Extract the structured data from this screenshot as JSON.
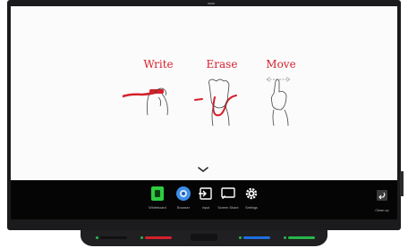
{
  "gestures": [
    {
      "label": "Write",
      "icon": "hand-writing-with-pen-icon"
    },
    {
      "label": "Erase",
      "icon": "palm-erasing-icon"
    },
    {
      "label": "Move",
      "icon": "two-finger-move-icon"
    }
  ],
  "taskbar": {
    "apps": [
      {
        "label": "Whiteboard",
        "icon": "whiteboard-icon",
        "color": "#2ecc40"
      },
      {
        "label": "Browser",
        "icon": "browser-globe-icon",
        "color": "#3b8ee8"
      },
      {
        "label": "Input",
        "icon": "input-source-icon",
        "color": "#ffffff"
      },
      {
        "label": "Screen Share",
        "icon": "screen-share-icon",
        "color": "#ffffff"
      },
      {
        "label": "Settings",
        "icon": "gear-icon",
        "color": "#ffffff"
      }
    ],
    "exit": {
      "label": "Clean up",
      "icon": "exit-arrow-icon"
    }
  },
  "pen_tray": {
    "pens": [
      {
        "color": "#111111",
        "name": "black"
      },
      {
        "color": "#d6202c",
        "name": "red"
      },
      {
        "color": "#1f6fe0",
        "name": "blue"
      },
      {
        "color": "#27b84a",
        "name": "green"
      }
    ]
  },
  "colors": {
    "accent": "#d6202c",
    "bezel": "#1b1b1d",
    "taskbar": "#050505",
    "screen": "#fbfbfb"
  }
}
